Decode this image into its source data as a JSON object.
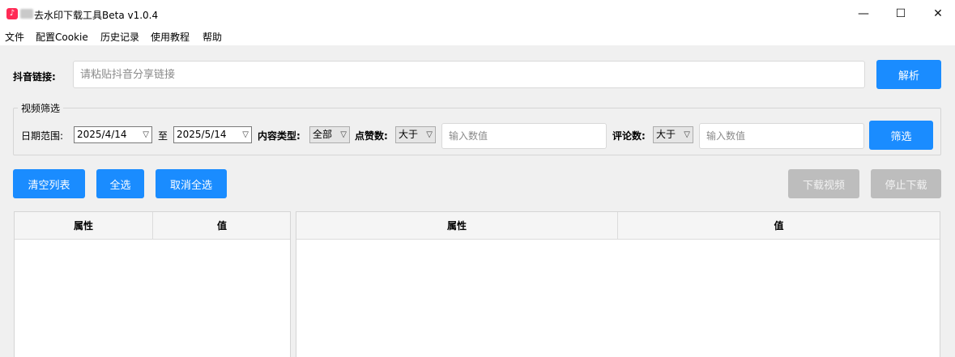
{
  "window": {
    "title": "去水印下载工具Beta v1.0.4",
    "minimize": "—",
    "maximize": "☐",
    "close": "✕"
  },
  "menu": [
    "文件",
    "配置Cookie",
    "历史记录",
    "使用教程",
    "帮助"
  ],
  "link": {
    "label": "抖音链接:",
    "placeholder": "请粘贴抖音分享链接",
    "parse_button": "解析"
  },
  "filter": {
    "group_title": "视频筛选",
    "date_label": "日期范围:",
    "date_from": "2025/4/14",
    "to_label": "至",
    "date_to": "2025/5/14",
    "type_label": "内容类型:",
    "type_value": "全部",
    "likes_label": "点赞数:",
    "likes_op": "大于",
    "likes_placeholder": "输入数值",
    "comments_label": "评论数:",
    "comments_op": "大于",
    "comments_placeholder": "输入数值",
    "filter_button": "筛选"
  },
  "actions": {
    "clear": "清空列表",
    "select_all": "全选",
    "deselect_all": "取消全选",
    "download": "下载视频",
    "stop": "停止下载"
  },
  "left_table": {
    "headers": [
      "属性",
      "值"
    ]
  },
  "right_table": {
    "headers": [
      "属性",
      "值"
    ]
  },
  "colors": {
    "accent": "#1a8cff",
    "disabled": "#bdbdbd",
    "brand": "#ff2a55"
  }
}
